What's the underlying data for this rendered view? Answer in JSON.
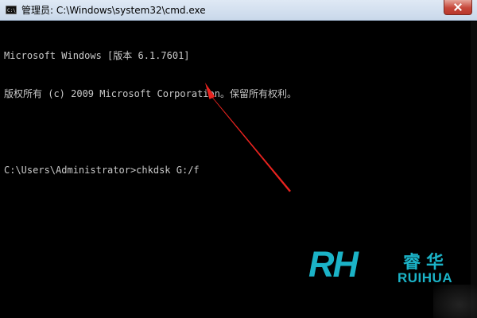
{
  "window": {
    "title": "管理员: C:\\Windows\\system32\\cmd.exe",
    "app_icon_glyph": "C:\\"
  },
  "console": {
    "lines": [
      "Microsoft Windows [版本 6.1.7601]",
      "版权所有 (c) 2009 Microsoft Corporation。保留所有权利。",
      "",
      "C:\\Users\\Administrator>chkdsk G:/f"
    ]
  },
  "watermark": {
    "mark": "RH",
    "chinese": "睿华",
    "english": "RUIHUA"
  },
  "colors": {
    "console_text": "#c9c9c9",
    "arrow": "#e8231f",
    "brand": "#1bb3c7"
  }
}
